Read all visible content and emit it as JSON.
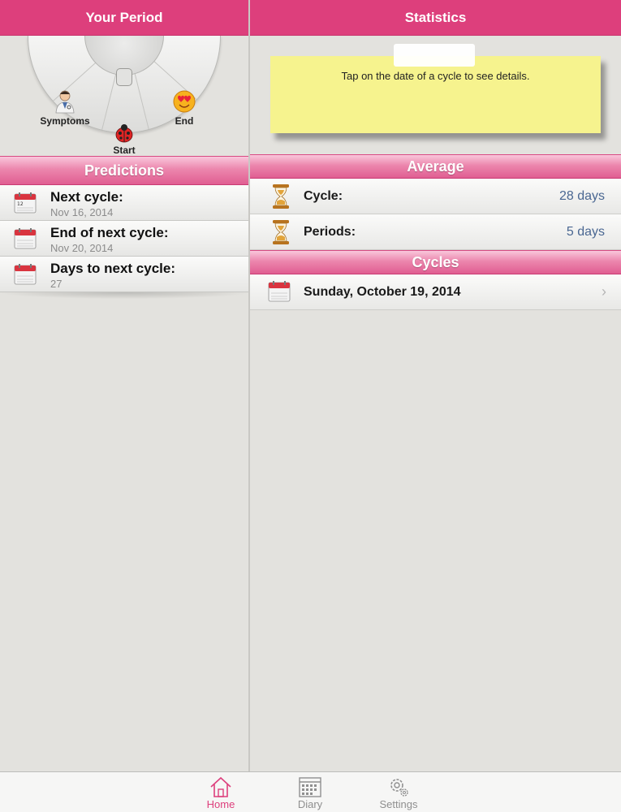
{
  "left": {
    "title": "Your Period",
    "wheel": {
      "symptoms_label": "Symptoms",
      "start_label": "Start",
      "end_label": "End"
    },
    "predictions": {
      "header": "Predictions",
      "items": [
        {
          "title": "Next cycle:",
          "value": "Nov 16, 2014"
        },
        {
          "title": "End of next cycle:",
          "value": "Nov 20, 2014"
        },
        {
          "title": "Days to next cycle:",
          "value": "27"
        }
      ]
    }
  },
  "right": {
    "title": "Statistics",
    "note": "Tap on the date of a cycle to see details.",
    "average": {
      "header": "Average",
      "rows": [
        {
          "label": "Cycle:",
          "value": "28 days"
        },
        {
          "label": "Periods:",
          "value": "5 days"
        }
      ]
    },
    "cycles": {
      "header": "Cycles",
      "items": [
        {
          "label": "Sunday, October 19, 2014"
        }
      ]
    }
  },
  "tabs": [
    {
      "label": "Home",
      "active": true,
      "icon": "house-icon"
    },
    {
      "label": "Diary",
      "active": false,
      "icon": "calendar-icon"
    },
    {
      "label": "Settings",
      "active": false,
      "icon": "gear-icon"
    }
  ],
  "colors": {
    "accent": "#dd3f7c",
    "note": "#f6f38e",
    "stat_value": "#4a6792"
  }
}
